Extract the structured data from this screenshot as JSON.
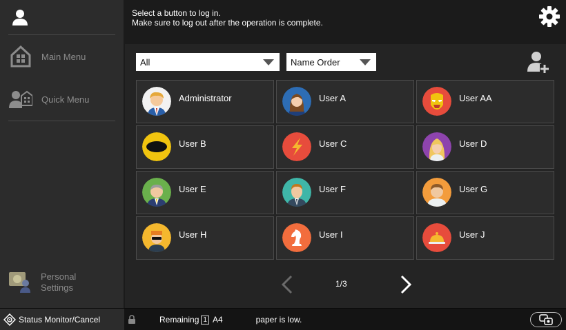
{
  "sidebar": {
    "top_icon": "user-icon",
    "items": [
      {
        "label": "Main Menu",
        "icon": "home-icon"
      },
      {
        "label": "Quick Menu",
        "icon": "quick-menu-icon"
      }
    ],
    "personal": {
      "label_line1": "Personal",
      "label_line2": "Settings",
      "icon": "personal-settings-icon"
    }
  },
  "header": {
    "line1": "Select a button to log in.",
    "line2": "Make sure to log out after the operation is complete.",
    "settings_icon": "gear-icon"
  },
  "filters": {
    "group_value": "All",
    "sort_value": "Name Order",
    "add_user_icon": "add-user-icon"
  },
  "users": [
    {
      "name": "Administrator",
      "avatar": "administrator-avatar"
    },
    {
      "name": "User A",
      "avatar": "user-a-avatar"
    },
    {
      "name": "User AA",
      "avatar": "user-aa-avatar"
    },
    {
      "name": "User B",
      "avatar": "user-b-avatar"
    },
    {
      "name": "User C",
      "avatar": "user-c-avatar"
    },
    {
      "name": "User D",
      "avatar": "user-d-avatar"
    },
    {
      "name": "User E",
      "avatar": "user-e-avatar"
    },
    {
      "name": "User F",
      "avatar": "user-f-avatar"
    },
    {
      "name": "User G",
      "avatar": "user-g-avatar"
    },
    {
      "name": "User H",
      "avatar": "user-h-avatar"
    },
    {
      "name": "User I",
      "avatar": "user-i-avatar"
    },
    {
      "name": "User J",
      "avatar": "user-j-avatar"
    }
  ],
  "pager": {
    "indicator": "1/3"
  },
  "statusbar": {
    "monitor_label": "Status Monitor/Cancel",
    "remaining_label": "Remaining",
    "tray_number": "1",
    "paper_size": "A4",
    "paper_message": "paper is low."
  },
  "colors": {
    "sidebar_bg": "#2c2c2c",
    "main_bg": "#242424",
    "tile_bg": "#2c2c2c",
    "tile_border": "#4b4b4b",
    "status_bg": "#141414"
  }
}
